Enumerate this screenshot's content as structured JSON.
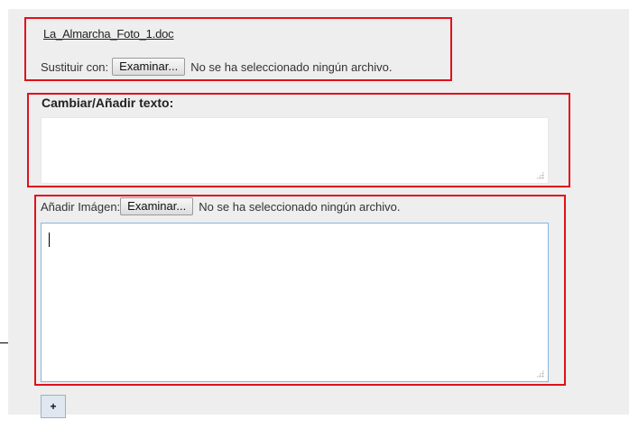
{
  "file_section": {
    "file_link": "La_Almarcha_Foto_1.doc",
    "replace_label": "Sustituir con:",
    "browse_button": "Examinar...",
    "no_file_text": "No se ha seleccionado ningún archivo."
  },
  "text_section": {
    "heading": "Cambiar/Añadir texto:",
    "textarea_value": ""
  },
  "image_section": {
    "label": "Añadir Imágen:",
    "browse_button": "Examinar...",
    "no_file_text": "No se ha seleccionado ningún archivo.",
    "textarea_value": ""
  },
  "add_button": {
    "label": "+"
  },
  "colors": {
    "highlight_border": "#e0101a",
    "panel_background": "#eeeeee",
    "focus_border": "#86b6dc"
  }
}
